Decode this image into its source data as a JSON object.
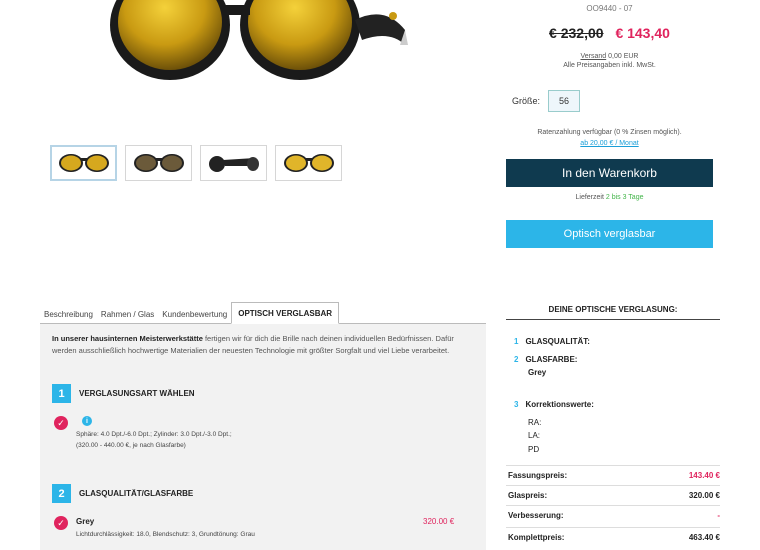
{
  "product": {
    "model_no": "OO9440 - 07",
    "old_price": "€ 232,00",
    "new_price": "€ 143,40",
    "shipping_link": "Versand",
    "shipping_value": "0,00 EUR",
    "incl_text": "Alle Preisangaben inkl. MwSt.",
    "size_label": "Größe:",
    "size_value": "56",
    "finance_text": "Ratenzahlung verfügbar (0 % Zinsen möglich).",
    "finance_link": "ab 20,00 € / Monat",
    "cart_button": "In den Warenkorb",
    "delivery_prefix": "Lieferzeit",
    "delivery_value": "2 bis 3 Tage",
    "optic_button": "Optisch verglasbar"
  },
  "tabs": [
    {
      "label": "Beschreibung"
    },
    {
      "label": "Rahmen / Glas"
    },
    {
      "label": "Kundenbewertung"
    },
    {
      "label": "OPTISCH VERGLASBAR"
    }
  ],
  "panel": {
    "intro_bold": "In unserer hausinternen Meisterwerkstätte",
    "intro_rest": " fertigen wir für dich die Brille nach deinen individuellen Bedürfnissen. Dafür werden ausschließlich hochwertige Materialien der neuesten Technologie mit größter Sorgfalt und viel Liebe verarbeitet.",
    "step1": {
      "num": "1",
      "title": "VERGLASUNGSART WÄHLEN"
    },
    "step1_desc_line1": "Sphäre: 4.0 Dpt./-6.0 Dpt.; Zylinder: 3.0 Dpt./-3.0 Dpt.;",
    "step1_desc_line2": "(320.00 - 440.00 €, je nach Glasfarbe)",
    "step2": {
      "num": "2",
      "title": "GLASQUALITÄT/GLASFARBE"
    },
    "grey_name": "Grey",
    "grey_price": "320.00 €",
    "grey_desc": "Lichtdurchlässigkeit: 18.0, Blendschutz: 3, Grundtönung: Grau"
  },
  "summary": {
    "title": "DEINE OPTISCHE VERGLASUNG:",
    "items": [
      {
        "num": "1",
        "label": "GLASQUALITÄT:"
      },
      {
        "num": "2",
        "label": "GLASFARBE:",
        "value": "Grey"
      },
      {
        "num": "3",
        "label": "Korrektionswerte:"
      }
    ],
    "ra": "RA:",
    "la": "LA:",
    "pd": "PD",
    "lines": [
      {
        "label": "Fassungspreis:",
        "value": "143.40 €"
      },
      {
        "label": "Glaspreis:",
        "value": "320.00 €"
      },
      {
        "label": "Verbesserung:",
        "value": "-"
      },
      {
        "label": "Komplettpreis:",
        "value": "463.40 €"
      }
    ]
  },
  "icons": {
    "check": "check-icon",
    "info": "info-icon"
  },
  "colors": {
    "accent_blue": "#2cb5e8",
    "dark_blue": "#0f3a4f",
    "price_pink": "#e0245e",
    "delivery_green": "#43b54a"
  }
}
